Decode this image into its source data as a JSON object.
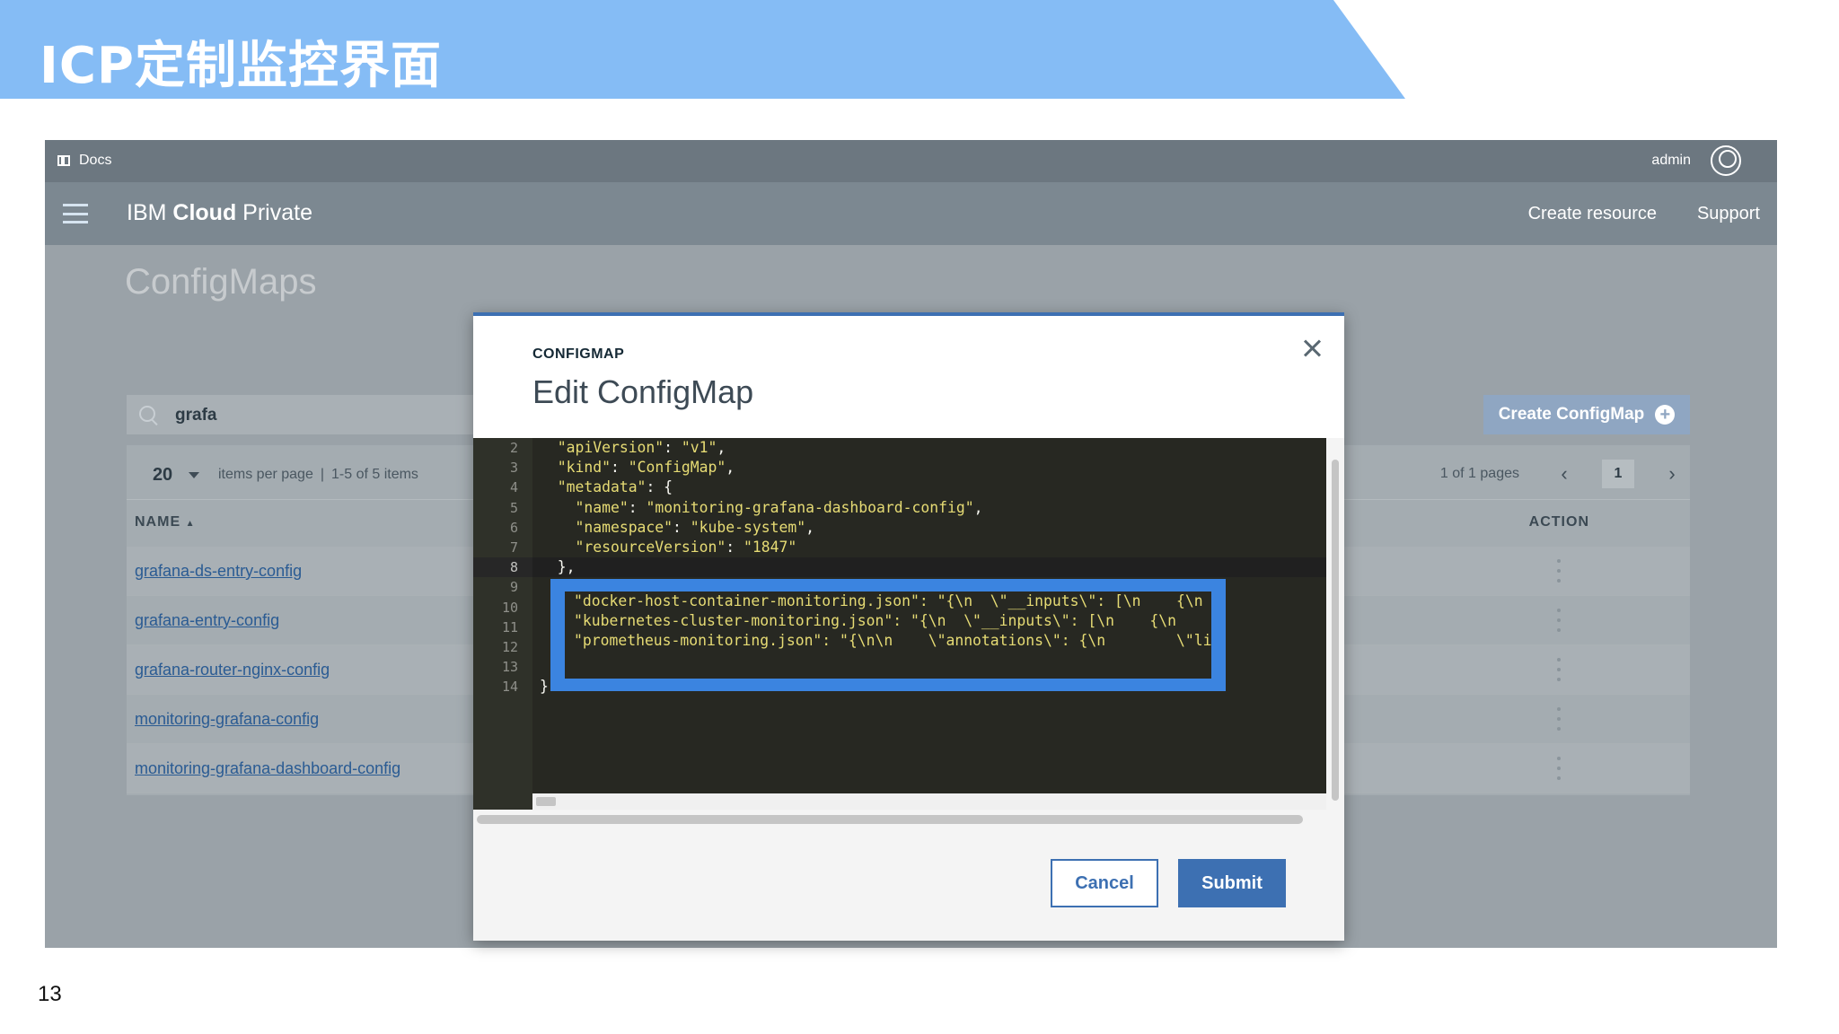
{
  "slide": {
    "title": "ICP定制监控界面",
    "page_number": "13"
  },
  "topbar": {
    "docs_label": "Docs",
    "user_label": "admin"
  },
  "navbar": {
    "brand_prefix": "IBM ",
    "brand_bold": "Cloud",
    "brand_suffix": " Private",
    "links": [
      "Create resource",
      "Support"
    ]
  },
  "page": {
    "title": "ConfigMaps"
  },
  "search": {
    "value": "grafa"
  },
  "create_button": {
    "label": "Create ConfigMap"
  },
  "pagination": {
    "per_page": "20",
    "per_page_label": "items per page",
    "range": "1-5 of 5 items",
    "pages_label": "1 of 1 pages",
    "current_page": "1"
  },
  "table": {
    "headers": {
      "name": "NAME",
      "action": "ACTION"
    },
    "rows": [
      "grafana-ds-entry-config",
      "grafana-entry-config",
      "grafana-router-nginx-config",
      "monitoring-grafana-config",
      "monitoring-grafana-dashboard-config"
    ]
  },
  "modal": {
    "label": "CONFIGMAP",
    "title": "Edit ConfigMap",
    "cancel": "Cancel",
    "submit": "Submit",
    "line_numbers": [
      "2",
      "3",
      "4",
      "5",
      "6",
      "7",
      "8",
      "9",
      "10",
      "11",
      "12",
      "13",
      "14"
    ],
    "code_lines": [
      "  \"apiVersion\": \"v1\",",
      "  \"kind\": \"ConfigMap\",",
      "  \"metadata\": {",
      "    \"name\": \"monitoring-grafana-dashboard-config\",",
      "    \"namespace\": \"kube-system\",",
      "    \"resourceVersion\": \"1847\"",
      "  },",
      "",
      "",
      "",
      "",
      "",
      "}"
    ],
    "highlight_lines": [
      "\"docker-host-container-monitoring.json\": \"{\\n  \\\"__inputs\\\": [\\n    {\\n      \\\"name\\",
      "\"kubernetes-cluster-monitoring.json\": \"{\\n  \\\"__inputs\\\": [\\n    {\\n      \\\"name\\\":",
      "\"prometheus-monitoring.json\": \"{\\n\\n    \\\"annotations\\\": {\\n        \\\"list\\\": [ ]\\n"
    ]
  },
  "icons": [
    "docs-icon",
    "user-icon",
    "hamburger-icon",
    "search-icon",
    "plus-icon",
    "chevron-down-icon",
    "chevron-left-icon",
    "chevron-right-icon",
    "sort-up-icon",
    "kebab-icon",
    "close-icon"
  ],
  "colors": {
    "banner": "#85bcf5",
    "primary": "#3d70b2",
    "editor_bg": "#272822",
    "string": "#e6db74",
    "highlight": "#3b84e0"
  }
}
